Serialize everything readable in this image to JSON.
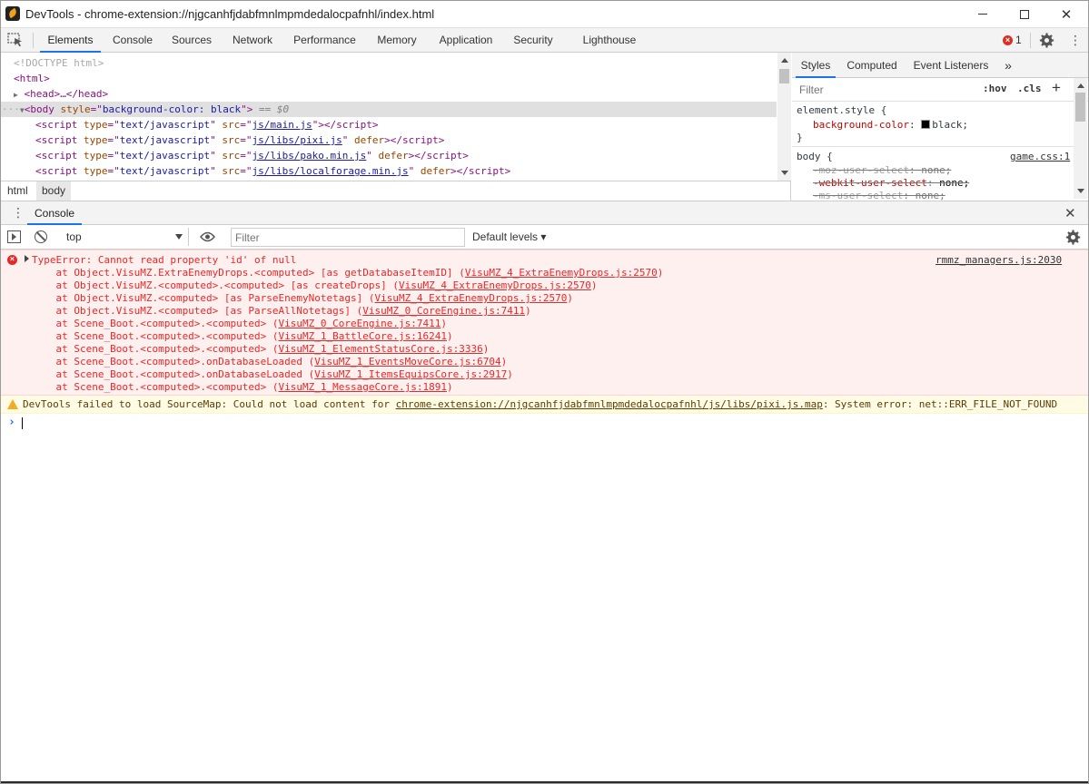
{
  "window": {
    "title": "DevTools - chrome-extension://njgcanhfjdabfmnlmpmdedalocpafnhl/index.html"
  },
  "main_tabs": [
    "Elements",
    "Console",
    "Sources",
    "Network",
    "Performance",
    "Memory",
    "Application",
    "Security",
    "Lighthouse"
  ],
  "active_tab": "Elements",
  "error_badge": {
    "count": "1"
  },
  "elements": {
    "doctype": "<!DOCTYPE html>",
    "html_open": "<html>",
    "head_collapsed": "<head>…</head>",
    "body_tag": "body",
    "body_attr": "style",
    "body_val": "background-color: black",
    "body_dollar": "== $0",
    "scripts": [
      {
        "src": "js/main.js",
        "defer": ""
      },
      {
        "src": "js/libs/pixi.js",
        "defer": " defer"
      },
      {
        "src": "js/libs/pako.min.js",
        "defer": " defer"
      },
      {
        "src": "js/libs/localforage.min.js",
        "defer": " defer"
      }
    ],
    "script_type": "text/javascript"
  },
  "breadcrumb": [
    "html",
    "body"
  ],
  "styles": {
    "tabs": [
      "Styles",
      "Computed",
      "Event Listeners"
    ],
    "filter_placeholder": "Filter",
    "hov": ":hov",
    "cls": ".cls",
    "element_style_selector": "element.style {",
    "element_style_prop": "background-color",
    "element_style_value": "black;",
    "close_brace": "}",
    "body_selector": "body {",
    "body_source": "game.css:1",
    "body_props": [
      {
        "prop": "-moz-user-select",
        "value": "none;"
      },
      {
        "prop": "-webkit-user-select",
        "value": "none;"
      },
      {
        "prop": "-ms-user-select",
        "value": "none;"
      }
    ]
  },
  "drawer": {
    "tab": "Console"
  },
  "console_toolbar": {
    "context": "top",
    "filter_placeholder": "Filter",
    "levels": "Default levels ▾"
  },
  "console": {
    "error": {
      "message": "TypeError: Cannot read property 'id' of null",
      "source": "rmmz_managers.js:2030",
      "stack": [
        {
          "text": "    at Object.VisuMZ.ExtraEnemyDrops.<computed> [as getDatabaseItemID] (",
          "link": "VisuMZ_4_ExtraEnemyDrops.js:2570"
        },
        {
          "text": "    at Object.VisuMZ.<computed>.<computed> [as createDrops] (",
          "link": "VisuMZ_4_ExtraEnemyDrops.js:2570"
        },
        {
          "text": "    at Object.VisuMZ.<computed> [as ParseEnemyNotetags] (",
          "link": "VisuMZ_4_ExtraEnemyDrops.js:2570"
        },
        {
          "text": "    at Object.VisuMZ.<computed> [as ParseAllNotetags] (",
          "link": "VisuMZ_0_CoreEngine.js:7411"
        },
        {
          "text": "    at Scene_Boot.<computed>.<computed> (",
          "link": "VisuMZ_0_CoreEngine.js:7411"
        },
        {
          "text": "    at Scene_Boot.<computed>.<computed> (",
          "link": "VisuMZ_1_BattleCore.js:16241"
        },
        {
          "text": "    at Scene_Boot.<computed>.<computed> (",
          "link": "VisuMZ_1_ElementStatusCore.js:3336"
        },
        {
          "text": "    at Scene_Boot.<computed>.onDatabaseLoaded (",
          "link": "VisuMZ_1_EventsMoveCore.js:6704"
        },
        {
          "text": "    at Scene_Boot.<computed>.onDatabaseLoaded (",
          "link": "VisuMZ_1_ItemsEquipsCore.js:2917"
        },
        {
          "text": "    at Scene_Boot.<computed>.<computed> (",
          "link": "VisuMZ_1_MessageCore.js:1891"
        }
      ]
    },
    "warning": {
      "prefix": "DevTools failed to load SourceMap: Could not load content for ",
      "link": "chrome-extension://njgcanhfjdabfmnlmpmdedalocpafnhl/js/libs/pixi.js.map",
      "suffix": ": System error: net::ERR_FILE_NOT_FOUND"
    }
  }
}
